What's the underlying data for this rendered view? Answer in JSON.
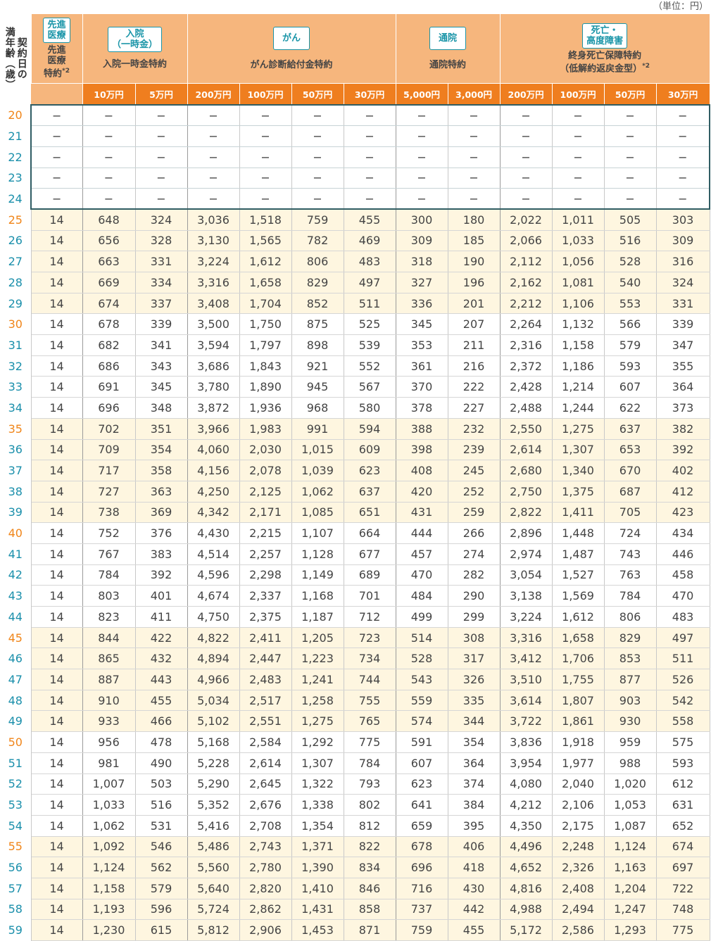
{
  "unit_label": "（単位：円）",
  "age_header": "契約日の\n満年齢（歳）",
  "groups": [
    {
      "category": "先進\n医療",
      "name": "先進\n医療\n特約",
      "note": "*2"
    },
    {
      "category": "入院\n（一時金）",
      "name": "入院一時金特約",
      "note": ""
    },
    {
      "category": "がん",
      "name": "がん診断給付金特約",
      "note": ""
    },
    {
      "category": "通院",
      "name": "通院特約",
      "note": ""
    },
    {
      "category": "死亡・\n高度障害",
      "name": "終身死亡保障特約\n（低解約返戻金型）",
      "note": "*2"
    }
  ],
  "sub_headers": [
    "10万円",
    "5万円",
    "200万円",
    "100万円",
    "50万円",
    "30万円",
    "5,000円",
    "3,000円",
    "200万円",
    "100万円",
    "50万円",
    "30万円"
  ],
  "colors": {
    "header_bg": "#f6b67d",
    "subheader_bg": "#ef7e1f",
    "teal": "#1a95a8",
    "age_orange": "#f08519",
    "age_blue": "#1a8fab",
    "stripe": "#fef6e0",
    "na_border": "#2f5c63"
  },
  "rows": [
    {
      "age": "20",
      "v": [
        "−",
        "−",
        "−",
        "−",
        "−",
        "−",
        "−",
        "−",
        "−",
        "−",
        "−",
        "−",
        "−"
      ]
    },
    {
      "age": "21",
      "v": [
        "−",
        "−",
        "−",
        "−",
        "−",
        "−",
        "−",
        "−",
        "−",
        "−",
        "−",
        "−",
        "−"
      ]
    },
    {
      "age": "22",
      "v": [
        "−",
        "−",
        "−",
        "−",
        "−",
        "−",
        "−",
        "−",
        "−",
        "−",
        "−",
        "−",
        "−"
      ]
    },
    {
      "age": "23",
      "v": [
        "−",
        "−",
        "−",
        "−",
        "−",
        "−",
        "−",
        "−",
        "−",
        "−",
        "−",
        "−",
        "−"
      ]
    },
    {
      "age": "24",
      "v": [
        "−",
        "−",
        "−",
        "−",
        "−",
        "−",
        "−",
        "−",
        "−",
        "−",
        "−",
        "−",
        "−"
      ]
    },
    {
      "age": "25",
      "v": [
        "14",
        "648",
        "324",
        "3,036",
        "1,518",
        "759",
        "455",
        "300",
        "180",
        "2,022",
        "1,011",
        "505",
        "303"
      ]
    },
    {
      "age": "26",
      "v": [
        "14",
        "656",
        "328",
        "3,130",
        "1,565",
        "782",
        "469",
        "309",
        "185",
        "2,066",
        "1,033",
        "516",
        "309"
      ]
    },
    {
      "age": "27",
      "v": [
        "14",
        "663",
        "331",
        "3,224",
        "1,612",
        "806",
        "483",
        "318",
        "190",
        "2,112",
        "1,056",
        "528",
        "316"
      ]
    },
    {
      "age": "28",
      "v": [
        "14",
        "669",
        "334",
        "3,316",
        "1,658",
        "829",
        "497",
        "327",
        "196",
        "2,162",
        "1,081",
        "540",
        "324"
      ]
    },
    {
      "age": "29",
      "v": [
        "14",
        "674",
        "337",
        "3,408",
        "1,704",
        "852",
        "511",
        "336",
        "201",
        "2,212",
        "1,106",
        "553",
        "331"
      ]
    },
    {
      "age": "30",
      "v": [
        "14",
        "678",
        "339",
        "3,500",
        "1,750",
        "875",
        "525",
        "345",
        "207",
        "2,264",
        "1,132",
        "566",
        "339"
      ]
    },
    {
      "age": "31",
      "v": [
        "14",
        "682",
        "341",
        "3,594",
        "1,797",
        "898",
        "539",
        "353",
        "211",
        "2,316",
        "1,158",
        "579",
        "347"
      ]
    },
    {
      "age": "32",
      "v": [
        "14",
        "686",
        "343",
        "3,686",
        "1,843",
        "921",
        "552",
        "361",
        "216",
        "2,372",
        "1,186",
        "593",
        "355"
      ]
    },
    {
      "age": "33",
      "v": [
        "14",
        "691",
        "345",
        "3,780",
        "1,890",
        "945",
        "567",
        "370",
        "222",
        "2,428",
        "1,214",
        "607",
        "364"
      ]
    },
    {
      "age": "34",
      "v": [
        "14",
        "696",
        "348",
        "3,872",
        "1,936",
        "968",
        "580",
        "378",
        "227",
        "2,488",
        "1,244",
        "622",
        "373"
      ]
    },
    {
      "age": "35",
      "v": [
        "14",
        "702",
        "351",
        "3,966",
        "1,983",
        "991",
        "594",
        "388",
        "232",
        "2,550",
        "1,275",
        "637",
        "382"
      ]
    },
    {
      "age": "36",
      "v": [
        "14",
        "709",
        "354",
        "4,060",
        "2,030",
        "1,015",
        "609",
        "398",
        "239",
        "2,614",
        "1,307",
        "653",
        "392"
      ]
    },
    {
      "age": "37",
      "v": [
        "14",
        "717",
        "358",
        "4,156",
        "2,078",
        "1,039",
        "623",
        "408",
        "245",
        "2,680",
        "1,340",
        "670",
        "402"
      ]
    },
    {
      "age": "38",
      "v": [
        "14",
        "727",
        "363",
        "4,250",
        "2,125",
        "1,062",
        "637",
        "420",
        "252",
        "2,750",
        "1,375",
        "687",
        "412"
      ]
    },
    {
      "age": "39",
      "v": [
        "14",
        "738",
        "369",
        "4,342",
        "2,171",
        "1,085",
        "651",
        "431",
        "259",
        "2,822",
        "1,411",
        "705",
        "423"
      ]
    },
    {
      "age": "40",
      "v": [
        "14",
        "752",
        "376",
        "4,430",
        "2,215",
        "1,107",
        "664",
        "444",
        "266",
        "2,896",
        "1,448",
        "724",
        "434"
      ]
    },
    {
      "age": "41",
      "v": [
        "14",
        "767",
        "383",
        "4,514",
        "2,257",
        "1,128",
        "677",
        "457",
        "274",
        "2,974",
        "1,487",
        "743",
        "446"
      ]
    },
    {
      "age": "42",
      "v": [
        "14",
        "784",
        "392",
        "4,596",
        "2,298",
        "1,149",
        "689",
        "470",
        "282",
        "3,054",
        "1,527",
        "763",
        "458"
      ]
    },
    {
      "age": "43",
      "v": [
        "14",
        "803",
        "401",
        "4,674",
        "2,337",
        "1,168",
        "701",
        "484",
        "290",
        "3,138",
        "1,569",
        "784",
        "470"
      ]
    },
    {
      "age": "44",
      "v": [
        "14",
        "823",
        "411",
        "4,750",
        "2,375",
        "1,187",
        "712",
        "499",
        "299",
        "3,224",
        "1,612",
        "806",
        "483"
      ]
    },
    {
      "age": "45",
      "v": [
        "14",
        "844",
        "422",
        "4,822",
        "2,411",
        "1,205",
        "723",
        "514",
        "308",
        "3,316",
        "1,658",
        "829",
        "497"
      ]
    },
    {
      "age": "46",
      "v": [
        "14",
        "865",
        "432",
        "4,894",
        "2,447",
        "1,223",
        "734",
        "528",
        "317",
        "3,412",
        "1,706",
        "853",
        "511"
      ]
    },
    {
      "age": "47",
      "v": [
        "14",
        "887",
        "443",
        "4,966",
        "2,483",
        "1,241",
        "744",
        "543",
        "326",
        "3,510",
        "1,755",
        "877",
        "526"
      ]
    },
    {
      "age": "48",
      "v": [
        "14",
        "910",
        "455",
        "5,034",
        "2,517",
        "1,258",
        "755",
        "559",
        "335",
        "3,614",
        "1,807",
        "903",
        "542"
      ]
    },
    {
      "age": "49",
      "v": [
        "14",
        "933",
        "466",
        "5,102",
        "2,551",
        "1,275",
        "765",
        "574",
        "344",
        "3,722",
        "1,861",
        "930",
        "558"
      ]
    },
    {
      "age": "50",
      "v": [
        "14",
        "956",
        "478",
        "5,168",
        "2,584",
        "1,292",
        "775",
        "591",
        "354",
        "3,836",
        "1,918",
        "959",
        "575"
      ]
    },
    {
      "age": "51",
      "v": [
        "14",
        "981",
        "490",
        "5,228",
        "2,614",
        "1,307",
        "784",
        "607",
        "364",
        "3,954",
        "1,977",
        "988",
        "593"
      ]
    },
    {
      "age": "52",
      "v": [
        "14",
        "1,007",
        "503",
        "5,290",
        "2,645",
        "1,322",
        "793",
        "623",
        "374",
        "4,080",
        "2,040",
        "1,020",
        "612"
      ]
    },
    {
      "age": "53",
      "v": [
        "14",
        "1,033",
        "516",
        "5,352",
        "2,676",
        "1,338",
        "802",
        "641",
        "384",
        "4,212",
        "2,106",
        "1,053",
        "631"
      ]
    },
    {
      "age": "54",
      "v": [
        "14",
        "1,062",
        "531",
        "5,416",
        "2,708",
        "1,354",
        "812",
        "659",
        "395",
        "4,350",
        "2,175",
        "1,087",
        "652"
      ]
    },
    {
      "age": "55",
      "v": [
        "14",
        "1,092",
        "546",
        "5,486",
        "2,743",
        "1,371",
        "822",
        "678",
        "406",
        "4,496",
        "2,248",
        "1,124",
        "674"
      ]
    },
    {
      "age": "56",
      "v": [
        "14",
        "1,124",
        "562",
        "5,560",
        "2,780",
        "1,390",
        "834",
        "696",
        "418",
        "4,652",
        "2,326",
        "1,163",
        "697"
      ]
    },
    {
      "age": "57",
      "v": [
        "14",
        "1,158",
        "579",
        "5,640",
        "2,820",
        "1,410",
        "846",
        "716",
        "430",
        "4,816",
        "2,408",
        "1,204",
        "722"
      ]
    },
    {
      "age": "58",
      "v": [
        "14",
        "1,193",
        "596",
        "5,724",
        "2,862",
        "1,431",
        "858",
        "737",
        "442",
        "4,988",
        "2,494",
        "1,247",
        "748"
      ]
    },
    {
      "age": "59",
      "v": [
        "14",
        "1,230",
        "615",
        "5,812",
        "2,906",
        "1,453",
        "871",
        "759",
        "455",
        "5,172",
        "2,586",
        "1,293",
        "775"
      ]
    }
  ]
}
